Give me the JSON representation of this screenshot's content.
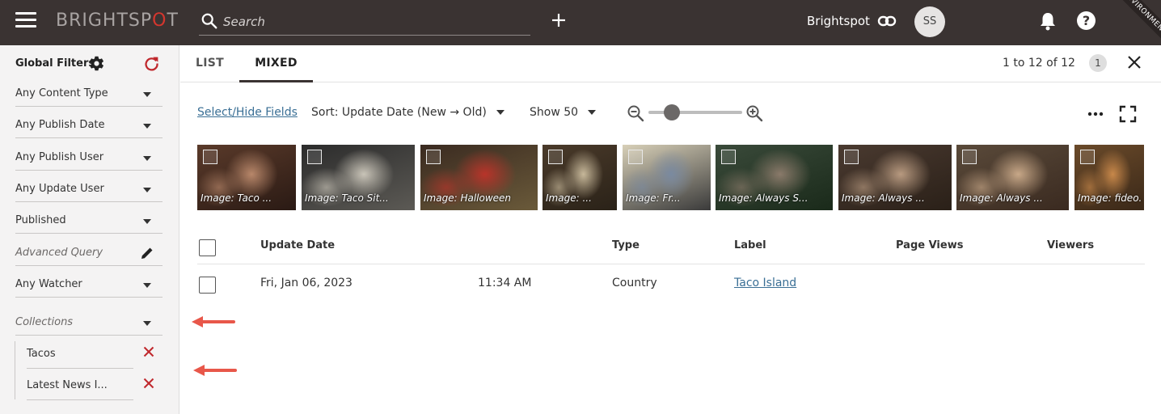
{
  "header": {
    "logo": {
      "main": "BRIGHTSP",
      "accent": "O",
      "end": "T"
    },
    "search_placeholder": "Search",
    "site_name": "Brightspot",
    "avatar_initials": "SS",
    "env_label": "ENVIRONMENT"
  },
  "sidebar": {
    "title": "Global Filters",
    "filters": [
      {
        "label": "Any Content Type",
        "italic": false,
        "control": "dropdown"
      },
      {
        "label": "Any Publish Date",
        "italic": false,
        "control": "dropdown"
      },
      {
        "label": "Any Publish User",
        "italic": false,
        "control": "dropdown"
      },
      {
        "label": "Any Update User",
        "italic": false,
        "control": "dropdown"
      },
      {
        "label": "Published",
        "italic": false,
        "control": "dropdown"
      },
      {
        "label": "Advanced Query",
        "italic": true,
        "control": "pencil"
      },
      {
        "label": "Any Watcher",
        "italic": false,
        "control": "dropdown"
      },
      {
        "label": "Collections",
        "italic": true,
        "control": "dropdown"
      }
    ],
    "collections": [
      {
        "label": "Tacos"
      },
      {
        "label": "Latest News I..."
      }
    ]
  },
  "main": {
    "tabs": [
      {
        "label": "LIST",
        "active": false
      },
      {
        "label": "MIXED",
        "active": true
      }
    ],
    "result_count": "1 to 12 of 12",
    "page_number": "1",
    "toolbar": {
      "select_hide_fields": "Select/Hide Fields",
      "sort": "Sort: Update Date (New → Old)",
      "show": "Show 50",
      "zoom_level": 0.25
    },
    "thumbnails": [
      {
        "caption": "Image: Taco ...",
        "colors": [
          "#5a3a2a",
          "#b8876a",
          "#2a1a14"
        ]
      },
      {
        "caption": "Image: Taco Sit...",
        "colors": [
          "#2b2b2b",
          "#c9c4b8",
          "#5c5a55"
        ]
      },
      {
        "caption": "Image: Halloween",
        "colors": [
          "#3a2a20",
          "#b8342a",
          "#6a5a3a"
        ]
      },
      {
        "caption": "Image: ...",
        "colors": [
          "#4a3a2a",
          "#c7b89a",
          "#2a2218"
        ]
      },
      {
        "caption": "Image: Fr...",
        "colors": [
          "#d8d0b8",
          "#7a8aa0",
          "#3a3a3a"
        ]
      },
      {
        "caption": "Image: Always S...",
        "colors": [
          "#3a4a3a",
          "#8a7a6a",
          "#1a2a1a"
        ]
      },
      {
        "caption": "Image: Always ...",
        "colors": [
          "#4a3a30",
          "#b89a80",
          "#2a2018"
        ]
      },
      {
        "caption": "Image: Always ...",
        "colors": [
          "#5a4a3a",
          "#c8a888",
          "#3a2a20"
        ]
      },
      {
        "caption": "Image: fideo...",
        "colors": [
          "#6a4a2a",
          "#c8884a",
          "#3a2818"
        ]
      }
    ],
    "table": {
      "headers": [
        "Update Date",
        "Type",
        "Label",
        "Page Views",
        "Viewers"
      ],
      "rows": [
        {
          "date": "Fri, Jan 06, 2023",
          "time": "11:34 AM",
          "type": "Country",
          "label": "Taco Island",
          "page_views": "",
          "viewers": ""
        }
      ]
    }
  },
  "colors": {
    "topbar": "#3a3332",
    "logo_gray": "#a8a3a2",
    "logo_red": "#d4362e",
    "link": "#3a6f95",
    "remove_red": "#c0282d",
    "annotation_arrow": "#e8574a"
  }
}
